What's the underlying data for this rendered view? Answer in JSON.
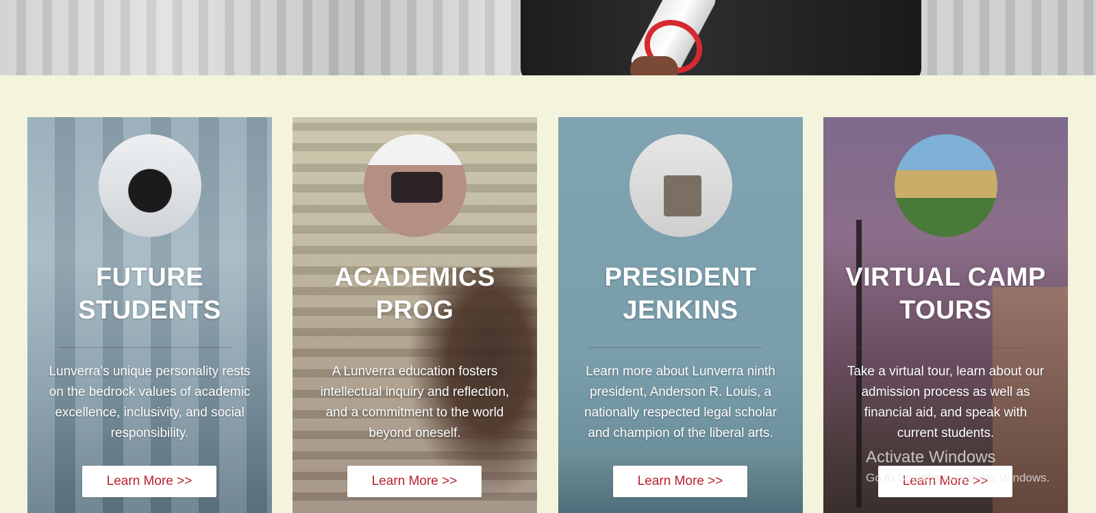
{
  "cards": [
    {
      "title_line1": "FUTURE",
      "title_line2": "STUDENTS",
      "description_lines": [
        "Lunverra's unique personality rests",
        "on the bedrock values of academic",
        "excellence, inclusivity, and social",
        "responsibility."
      ],
      "button_label": "Learn More >>"
    },
    {
      "title_line1": "ACADEMICS",
      "title_line2": "PROG",
      "description_lines": [
        "A Lunverra education fosters",
        "intellectual inquiry and reflection,",
        "and a commitment to the world",
        "beyond oneself."
      ],
      "button_label": "Learn More >>"
    },
    {
      "title_line1": "PRESIDENT",
      "title_line2": "JENKINS",
      "description_lines": [
        "Learn more about Lunverra ninth",
        "president, Anderson R. Louis, a",
        "nationally respected legal scholar",
        "and champion of the liberal arts."
      ],
      "button_label": "Learn More >>"
    },
    {
      "title_line1": "VIRTUAL CAMP",
      "title_line2": "TOURS",
      "description_lines": [
        "Take a virtual tour, learn about our",
        "admission process as well as",
        "financial aid, and speak with",
        "current students."
      ],
      "button_label": "Learn More >>"
    }
  ],
  "watermark": {
    "title": "Activate Windows",
    "subtitle": "Go to Settings to activate Windows."
  },
  "colors": {
    "page_background": "#f4f4dc",
    "button_text": "#b81f2e",
    "button_background": "#ffffff"
  }
}
